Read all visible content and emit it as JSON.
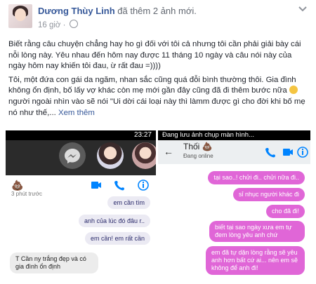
{
  "post": {
    "author": "Dương Thùy Linh",
    "action": "đã thêm 2 ảnh mới.",
    "time": "16 giờ ·",
    "paragraph1": "Biết rằng câu chuyện chẳng hay ho gì đối với tôi cả nhưng tôi cần phải giải bày cái nỗi lòng này. Yêu nhau đến hôm nay được 11 tháng 10 ngày và câu nói này của ngày hôm nay khiến tôi đau, ừ rất đau =))))",
    "paragraph2": "Tôi, một đứa con gái da ngăm, nhan sắc cũng quá đỗi bình thường thôi. Gia đình không ổn định, bố lấy vợ khác còn mẹ mới gần đây cũng đã đi thêm bước nữa",
    "paragraph2b": "người ngoài nhìn vào sẽ nói \"Ui dời cái loại này thì làmm được gì cho đời khi bố mẹ nó như thế,...",
    "see_more": "Xem thêm"
  },
  "left_shot": {
    "time": "23:27",
    "emoji_label": "💩",
    "time_ago": "3 phút trước",
    "sent": [
      "em cần tìm",
      "anh của lúc đó đâu r..",
      "em cần!  em rất cần"
    ],
    "received": "T Cần ny trắng đẹp và có gia đình ổn định"
  },
  "right_shot": {
    "top_status": "Đang lưu ảnh chụp màn hình...",
    "name": "Thối 💩",
    "status": "Đang online",
    "messages": [
      "tại sao..! chửi đi.. chửi nữa đi..",
      "sỉ nhục người khác đi",
      "cho đã đi!",
      "biết tại sao ngày xưa em tự đem lòng yêu anh chứ",
      "em đã tự dặn lòng rằng sẽ yêu anh hơn bất cứ ai... nên em sẽ không để anh đi!"
    ]
  },
  "colors": {
    "link": "#365899",
    "purple_bubble": "#e066d7",
    "messenger_blue": "#0084ff"
  }
}
